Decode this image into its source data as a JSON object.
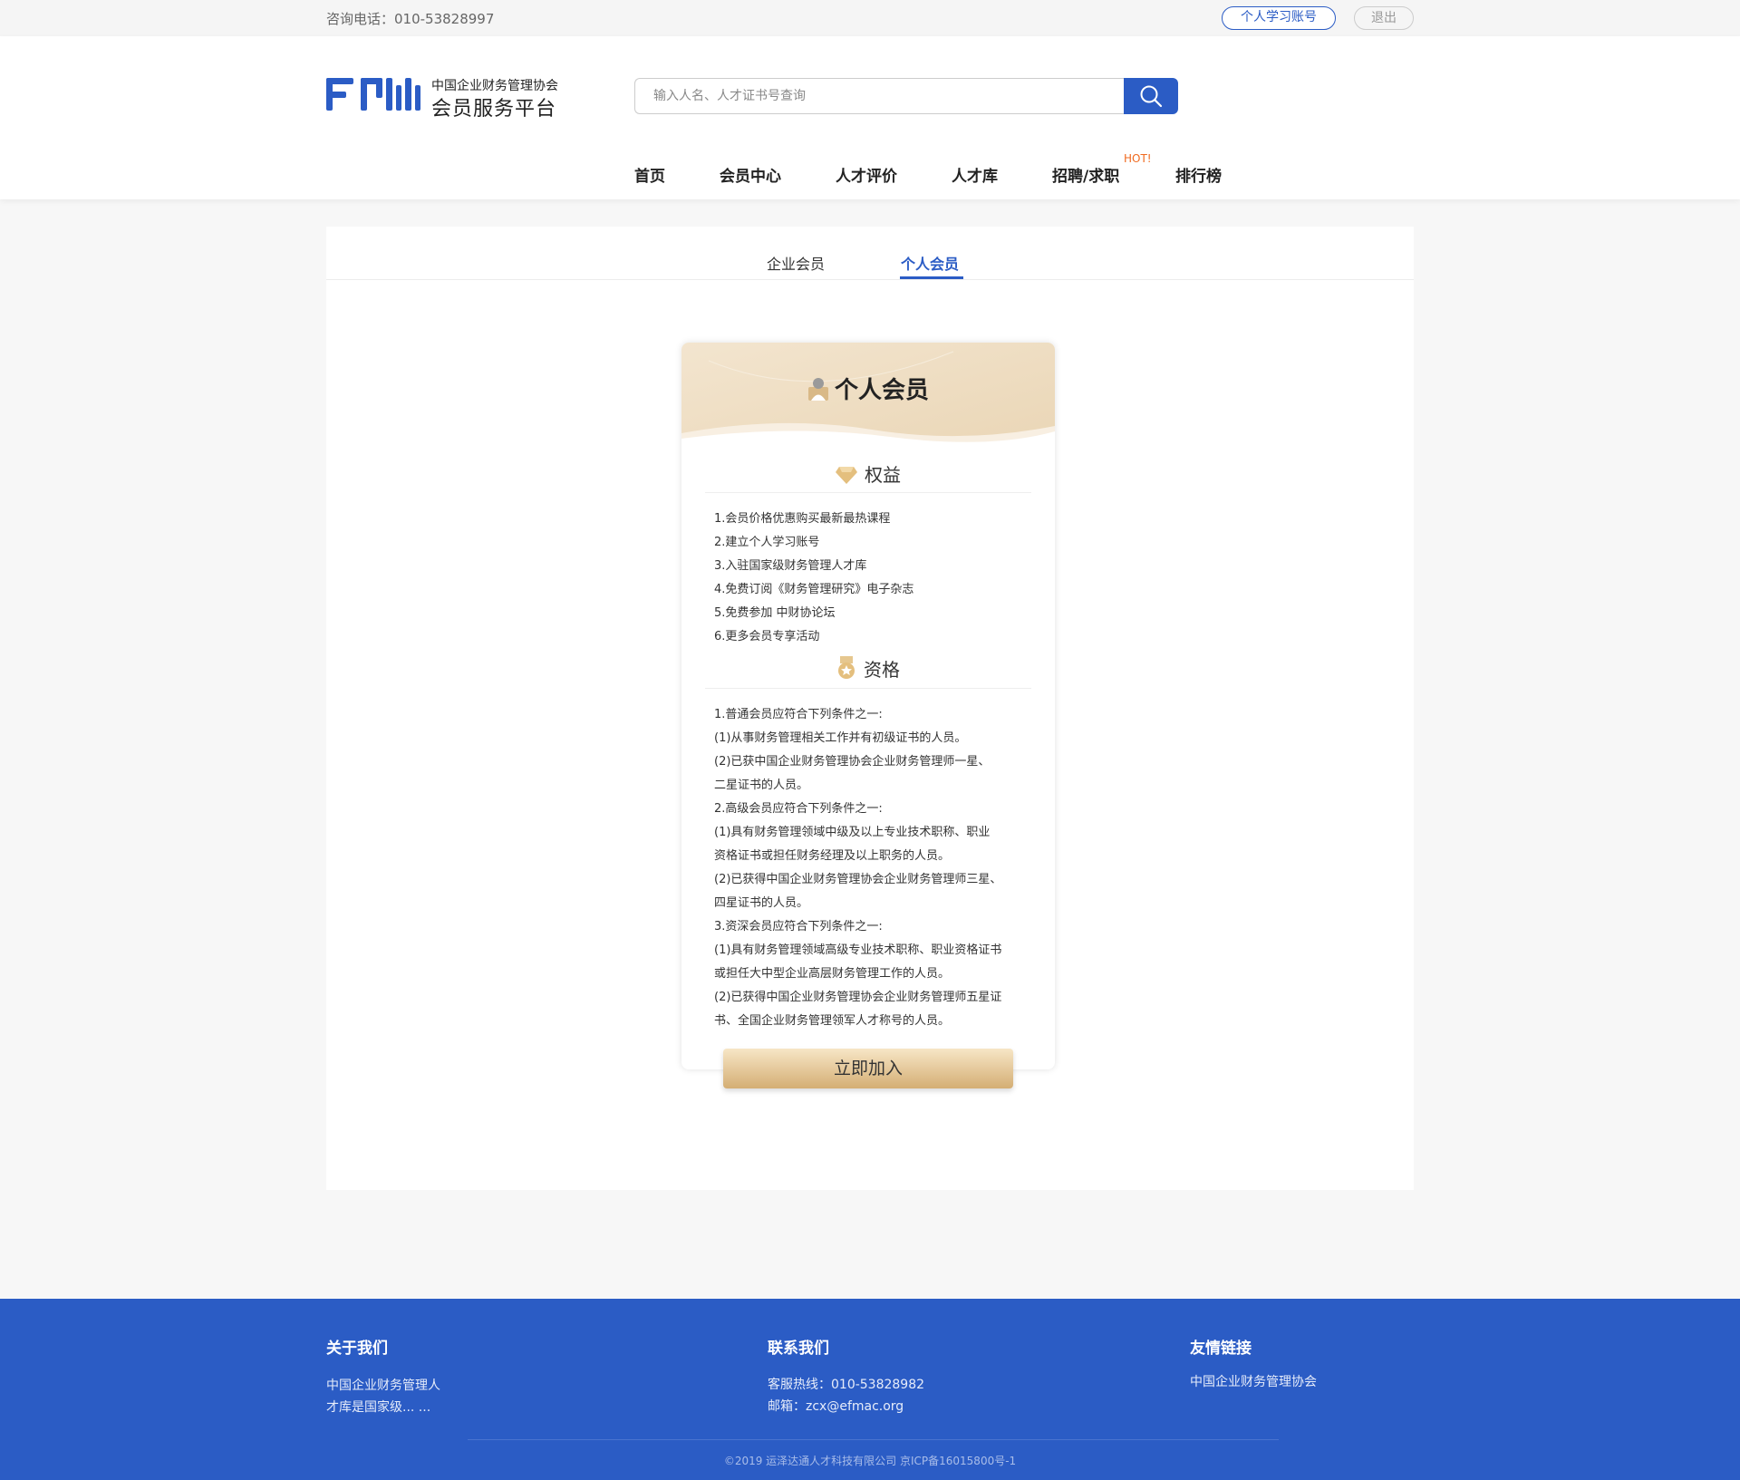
{
  "topbar": {
    "phone": "咨询电话：010-53828997",
    "account_button": "个人学习账号",
    "logout_button": "退出"
  },
  "header": {
    "org_name": "中国企业财务管理协会",
    "platform_name": "会员服务平台",
    "search_placeholder": "输入人名、人才证书号查询"
  },
  "nav": {
    "items": [
      "首页",
      "会员中心",
      "人才评价",
      "人才库",
      "招聘/求职",
      "排行榜"
    ],
    "hot_badge": "HOT!"
  },
  "tabs": [
    "企业会员",
    "个人会员"
  ],
  "membership_card": {
    "title": "个人会员",
    "benefits_title": "权益",
    "benefits": [
      "1.会员价格优惠购买最新最热课程",
      "2.建立个人学习账号",
      "3.入驻国家级财务管理人才库",
      "4.免费订阅《财务管理研究》电子杂志",
      "5.免费参加 中财协论坛",
      "6.更多会员专享活动"
    ],
    "qualifications_title": "资格",
    "qualifications": [
      "1.普通会员应符合下列条件之一:",
      "(1)从事财务管理相关工作并有初级证书的人员。",
      "(2)已获中国企业财务管理协会企业财务管理师一星、",
      "二星证书的人员。",
      "2.高级会员应符合下列条件之一:",
      "(1)具有财务管理领域中级及以上专业技术职称、职业",
      "资格证书或担任财务经理及以上职务的人员。",
      "(2)已获得中国企业财务管理协会企业财务管理师三星、",
      "四星证书的人员。",
      "3.资深会员应符合下列条件之一:",
      "(1)具有财务管理领域高级专业技术职称、职业资格证书",
      "或担任大中型企业高层财务管理工作的人员。",
      "(2)已获得中国企业财务管理协会企业财务管理师五星证",
      "书、全国企业财务管理领军人才称号的人员。"
    ],
    "join_button": "立即加入"
  },
  "footer": {
    "about_title": "关于我们",
    "about_text_1": "中国企业财务管理人",
    "about_text_2": "才库是国家级... ...",
    "contact_title": "联系我们",
    "hotline": "客服热线：010-53828982",
    "email": "邮箱：zcx@efmac.org",
    "links_title": "友情链接",
    "link_1": "中国企业财务管理协会",
    "copyright": "©2019 运泽达通人才科技有限公司  京ICP备16015800号-1"
  },
  "colors": {
    "brand_blue": "#2b5cc5",
    "gold": "#d4ae74",
    "hot": "#f06a1f"
  }
}
